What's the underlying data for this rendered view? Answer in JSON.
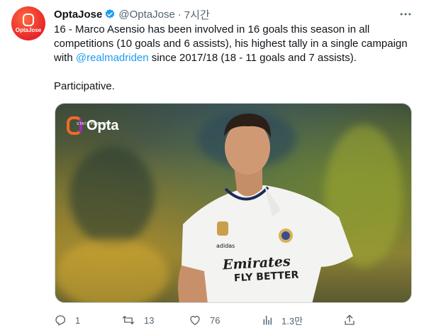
{
  "author": {
    "name": "OptaJose",
    "handle": "@OptaJose",
    "separator": "·",
    "time": "7시간",
    "avatar_text": "OptaJose"
  },
  "tweet": {
    "line_1": "16 - Marco Asensio has been involved in 16 goals this season in all competitions (10 goals and 6 assists), his highest tally in a single campaign with ",
    "mention": "@realmadriden",
    "line_2": " since 2017/18 (18 - 11 goals and 7 assists).",
    "line_3": "\n\nParticipative."
  },
  "media": {
    "logo_word": "Opta",
    "logo_sub": "STATS PERFORM",
    "shirt_sponsor_1": "Emirates",
    "shirt_sponsor_2": "FLY BETTER"
  },
  "actions": {
    "reply_count": "1",
    "retweet_count": "13",
    "like_count": "76",
    "views_count": "1.3만"
  },
  "colors": {
    "accent": "#1d9bf0",
    "muted": "#536471",
    "text": "#0f1419",
    "avatar": "#e8242a"
  },
  "icons": [
    "verified-icon",
    "more-icon",
    "reply-icon",
    "retweet-icon",
    "like-icon",
    "views-icon",
    "share-icon"
  ]
}
